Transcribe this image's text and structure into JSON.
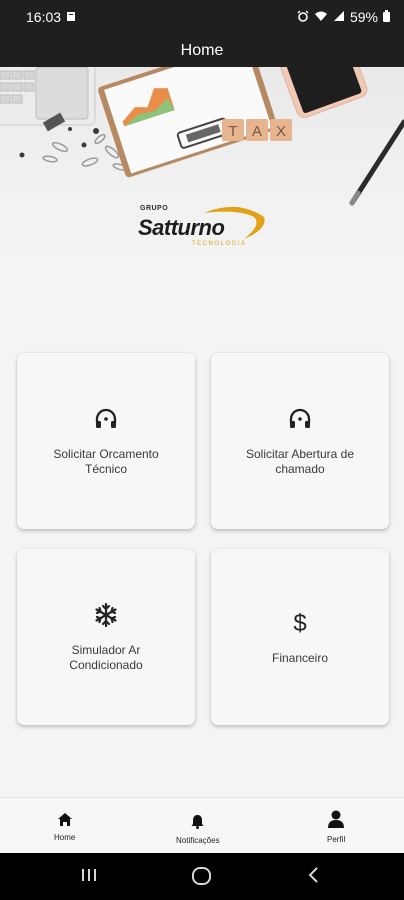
{
  "status_bar": {
    "time": "16:03",
    "battery": "59%"
  },
  "app_bar": {
    "title": "Home"
  },
  "banner": {
    "tax_letters": [
      "T",
      "A",
      "X"
    ]
  },
  "logo": {
    "small": "GRUPO",
    "main": "Satturno",
    "sub": "TECNOLOGIA"
  },
  "cards": [
    {
      "label": "Solicitar Orcamento Técnico",
      "icon": "headset-icon"
    },
    {
      "label": "Solicitar Abertura de chamado",
      "icon": "headset-icon"
    },
    {
      "label": "Simulador Ar Condicionado",
      "icon": "snowflake-icon"
    },
    {
      "label": "Financeiro",
      "icon": "dollar-icon"
    }
  ],
  "bottom_nav": [
    {
      "label": "Home",
      "icon": "home-icon"
    },
    {
      "label": "Notificações",
      "icon": "bell-icon"
    },
    {
      "label": "Perfil",
      "icon": "person-icon"
    }
  ],
  "colors": {
    "bar_bg": "#1f1f1f",
    "accent": "#e1a21a",
    "background": "#f4f4f4"
  }
}
